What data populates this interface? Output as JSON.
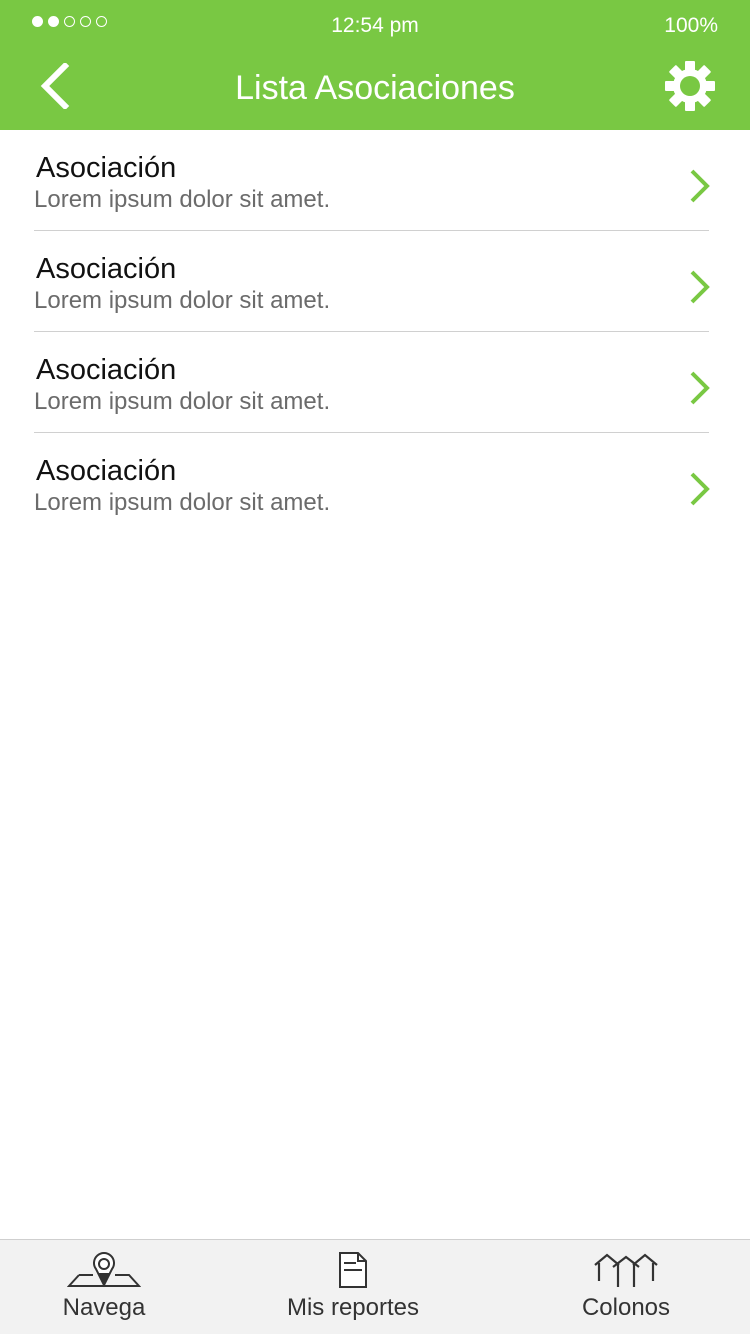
{
  "status_bar": {
    "time": "12:54 pm",
    "battery": "100%",
    "signal_bars_filled": 2,
    "signal_bars_total": 5
  },
  "header": {
    "title": "Lista Asociaciones",
    "background_color": "#79c843",
    "back_icon": "chevron-left-icon",
    "settings_icon": "gear-icon"
  },
  "list": {
    "items": [
      {
        "title": "Asociación",
        "subtitle": "Lorem ipsum dolor sit amet."
      },
      {
        "title": "Asociación",
        "subtitle": "Lorem ipsum dolor sit amet."
      },
      {
        "title": "Asociación",
        "subtitle": "Lorem ipsum dolor sit amet."
      },
      {
        "title": "Asociación",
        "subtitle": "Lorem ipsum dolor sit amet."
      }
    ],
    "chevron_color": "#79c843"
  },
  "tabbar": {
    "tabs": [
      {
        "label": "Navega",
        "icon": "map-pin-icon"
      },
      {
        "label": "Mis reportes",
        "icon": "document-icon"
      },
      {
        "label": "Colonos",
        "icon": "houses-icon"
      }
    ]
  }
}
